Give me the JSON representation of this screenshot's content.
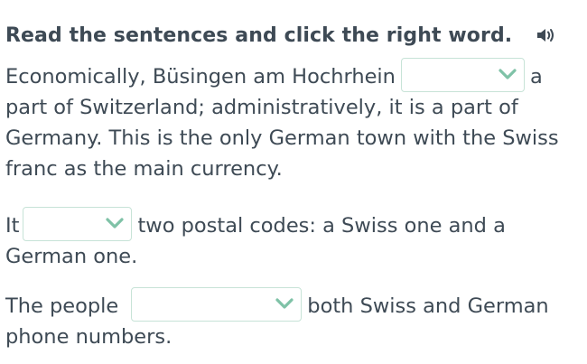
{
  "instruction": {
    "title": "Read the sentences and click the right word.",
    "audio_icon": "speaker-icon"
  },
  "sentences": [
    {
      "lines": [
        {
          "before": "Economically, Büsingen am Hochrhein",
          "after": "a"
        },
        {
          "text": "part of Switzerland; administratively, it is a part of"
        },
        {
          "text": "Germany. This is the only German town with the Swiss"
        },
        {
          "text": "franc as the main currency."
        }
      ],
      "dropdown": {
        "selected": ""
      }
    },
    {
      "lines": [
        {
          "before": "It",
          "after": "two postal codes: a Swiss one and a"
        },
        {
          "text": "German one."
        }
      ],
      "dropdown": {
        "selected": ""
      }
    },
    {
      "lines": [
        {
          "before": "The people",
          "after": "both Swiss and German"
        },
        {
          "text": "phone numbers."
        }
      ],
      "dropdown": {
        "selected": ""
      }
    }
  ],
  "colors": {
    "text": "#3e4a55",
    "dropdown_border": "#c7e3d7",
    "chevron": "#7fc2a7"
  }
}
